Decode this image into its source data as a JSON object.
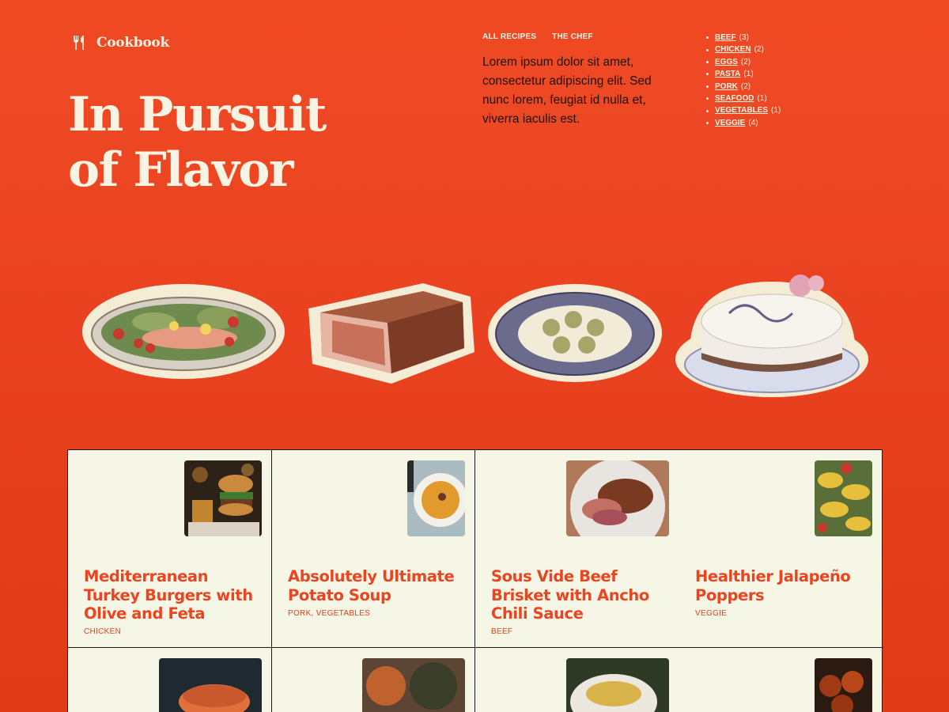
{
  "brand": {
    "name": "Cookbook",
    "icon": "fork-knife-icon"
  },
  "nav": {
    "items": [
      "ALL RECIPES",
      "THE CHEF"
    ]
  },
  "hero": {
    "line1": "In Pursuit",
    "line2": "of Flavor"
  },
  "intro": "Lorem ipsum dolor sit amet, consectetur adipiscing elit. Sed nunc lorem, feugiat id nulla et, viverra iaculis est.",
  "categories": [
    {
      "label": "BEEF",
      "count": "(3)"
    },
    {
      "label": "CHICKEN",
      "count": "(2)"
    },
    {
      "label": "EGGS",
      "count": "(2)"
    },
    {
      "label": "PASTA",
      "count": "(1)"
    },
    {
      "label": "PORK",
      "count": "(2)"
    },
    {
      "label": "SEAFOOD",
      "count": "(1)"
    },
    {
      "label": "VEGETABLES",
      "count": "(1)"
    },
    {
      "label": "VEGGIE",
      "count": "(4)"
    }
  ],
  "recipes": [
    {
      "title": "Mediterranean Turkey Burgers with Olive and Feta",
      "tags": "CHICKEN"
    },
    {
      "title": "Absolutely Ultimate Potato Soup",
      "tags": "PORK, VEGETABLES"
    },
    {
      "title": "Sous Vide Beef Brisket with Ancho Chili Sauce",
      "tags": "BEEF"
    },
    {
      "title": "Healthier Jalapeño Poppers",
      "tags": "VEGGIE"
    }
  ],
  "colors": {
    "background": "#ea4420",
    "cream": "#f8f3e2",
    "card": "#f5f6e6",
    "accent": "#ea4420"
  }
}
